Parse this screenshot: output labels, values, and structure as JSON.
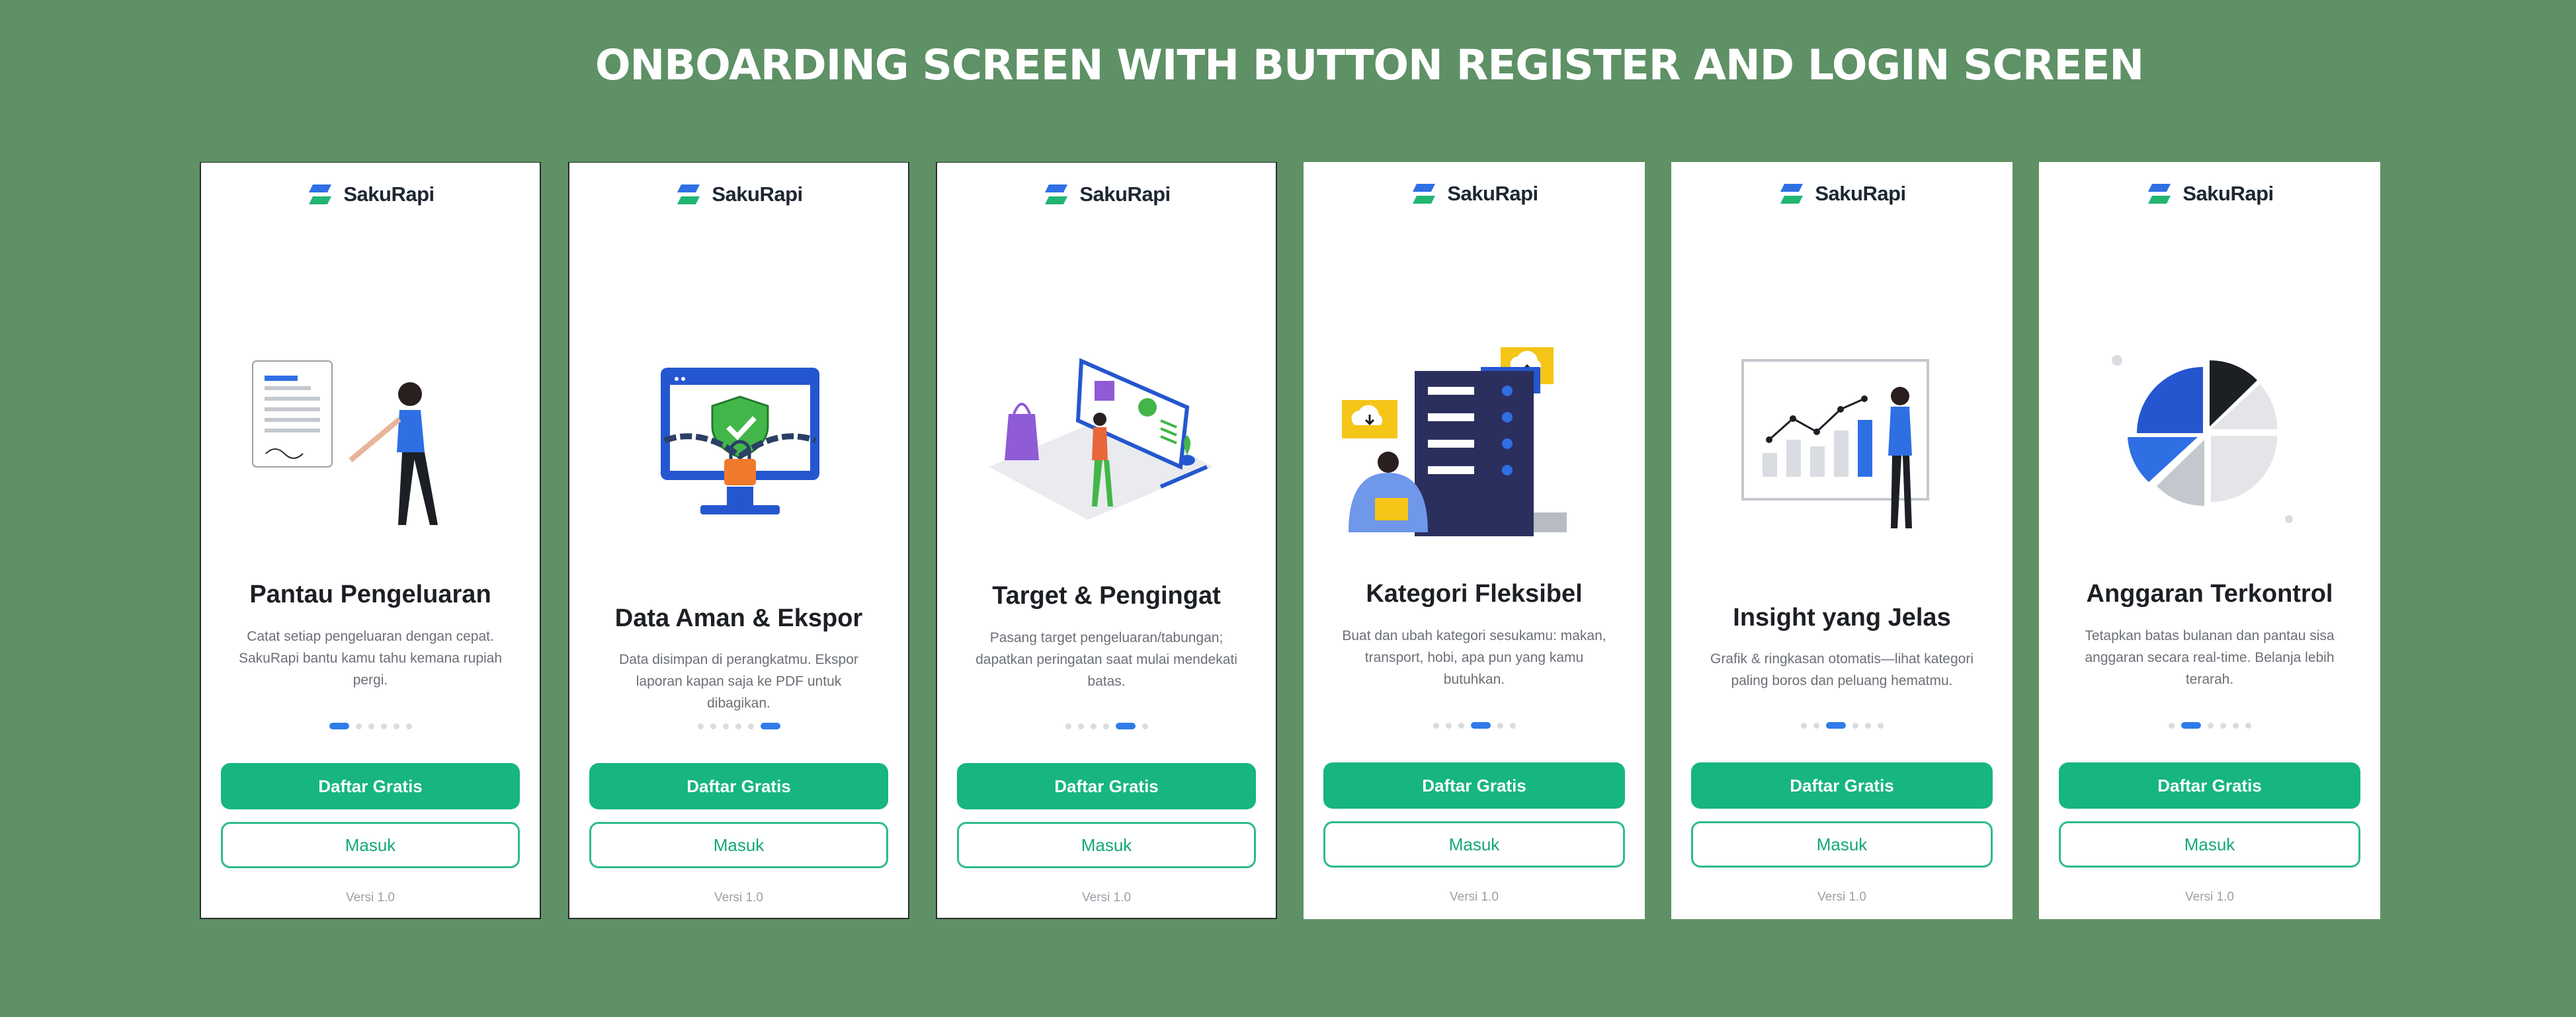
{
  "page_title": "ONBOARDING SCREEN WITH BUTTON REGISTER AND LOGIN SCREEN",
  "colors": {
    "background": "#5e9165",
    "primary_button": "#16b581",
    "active_dot": "#2f7bea",
    "logo_blue": "#2f6fe4",
    "logo_green": "#22b573"
  },
  "screens": [
    {
      "brand": "SakuRapi",
      "illustration": "person-signing-document",
      "title": "Pantau Pengeluaran",
      "description": "Catat setiap pengeluaran dengan cepat. SakuRapi bantu kamu tahu kemana rupiah pergi.",
      "active_page": 1,
      "total_pages": 6,
      "register_label": "Daftar Gratis",
      "login_label": "Masuk",
      "version": "Versi 1.0"
    },
    {
      "brand": "SakuRapi",
      "illustration": "secured-monitor-lock",
      "title": "Data Aman & Ekspor",
      "description": "Data disimpan di perangkatmu. Ekspor laporan kapan saja ke PDF untuk dibagikan.",
      "active_page": 6,
      "total_pages": 6,
      "register_label": "Daftar Gratis",
      "login_label": "Masuk",
      "version": "Versi 1.0"
    },
    {
      "brand": "SakuRapi",
      "illustration": "target-checklist-board",
      "title": "Target & Pengingat",
      "description": "Pasang target pengeluaran/tabungan; dapatkan peringatan saat mulai mendekati batas.",
      "active_page": 5,
      "total_pages": 6,
      "register_label": "Daftar Gratis",
      "login_label": "Masuk",
      "version": "Versi 1.0"
    },
    {
      "brand": "SakuRapi",
      "illustration": "server-cloud-categories",
      "title": "Kategori Fleksibel",
      "description": "Buat dan ubah kategori sesukamu: makan, transport, hobi, apa pun yang kamu butuhkan.",
      "active_page": 4,
      "total_pages": 6,
      "register_label": "Daftar Gratis",
      "login_label": "Masuk",
      "version": "Versi 1.0"
    },
    {
      "brand": "SakuRapi",
      "illustration": "person-presenting-chart",
      "title": "Insight yang Jelas",
      "description": "Grafik & ringkasan otomatis—lihat kategori paling boros dan peluang hematmu.",
      "active_page": 3,
      "total_pages": 6,
      "register_label": "Daftar Gratis",
      "login_label": "Masuk",
      "version": "Versi 1.0"
    },
    {
      "brand": "SakuRapi",
      "illustration": "pie-chart-budget",
      "title": "Anggaran Terkontrol",
      "description": "Tetapkan batas bulanan dan pantau sisa anggaran secara real-time. Belanja lebih terarah.",
      "active_page": 2,
      "total_pages": 6,
      "register_label": "Daftar Gratis",
      "login_label": "Masuk",
      "version": "Versi 1.0"
    }
  ]
}
